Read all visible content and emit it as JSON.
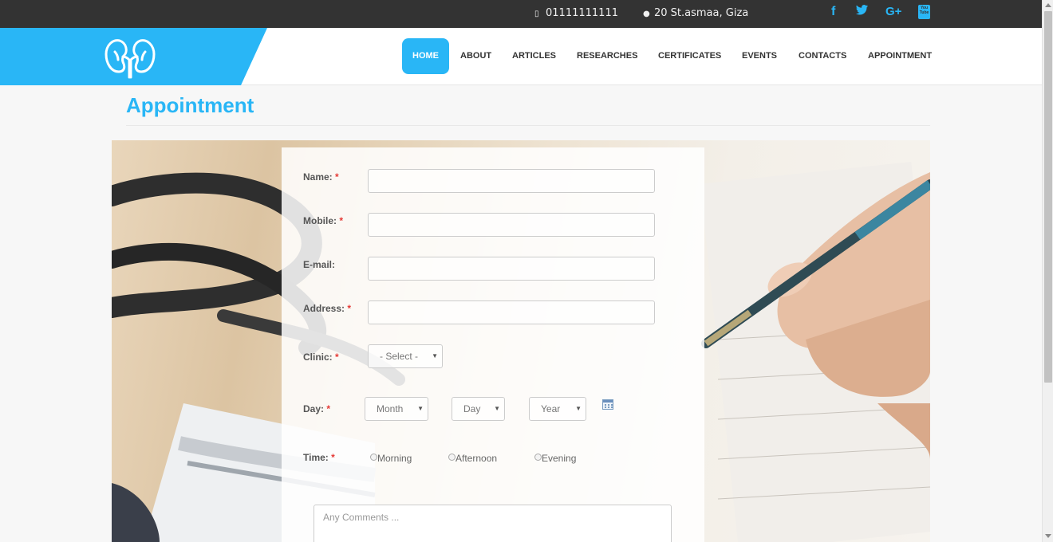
{
  "topbar": {
    "phone": "01111111111",
    "address": "20 St.asmaa, Giza",
    "social": [
      {
        "name": "facebook",
        "glyph": "f"
      },
      {
        "name": "twitter",
        "glyph": "t"
      },
      {
        "name": "google-plus",
        "glyph": "G+"
      },
      {
        "name": "youtube",
        "glyph": "You Tube"
      }
    ]
  },
  "header": {
    "logo_icon": "kidney-icon",
    "nav": [
      "HOME",
      "ABOUT",
      "ARTICLES",
      "RESEARCHES",
      "CERTIFICATES",
      "EVENTS",
      "CONTACTS",
      "APPOINTMENT"
    ],
    "active_nav": "HOME",
    "brand_color": "#29b6f6"
  },
  "page": {
    "title": "Appointment"
  },
  "form": {
    "name_label": "Name:",
    "mobile_label": "Mobile:",
    "email_label": "E-mail:",
    "address_label": "Address:",
    "clinic_label": "Clinic:",
    "clinic_value": "- Select -",
    "day_label": "Day:",
    "month_value": "Month",
    "day_value": "Day",
    "year_value": "Year",
    "time_label": "Time:",
    "time_options": [
      "Morning",
      "Afternoon",
      "Evening"
    ],
    "comments_placeholder": "Any Comments ...",
    "required_mark": "*"
  }
}
